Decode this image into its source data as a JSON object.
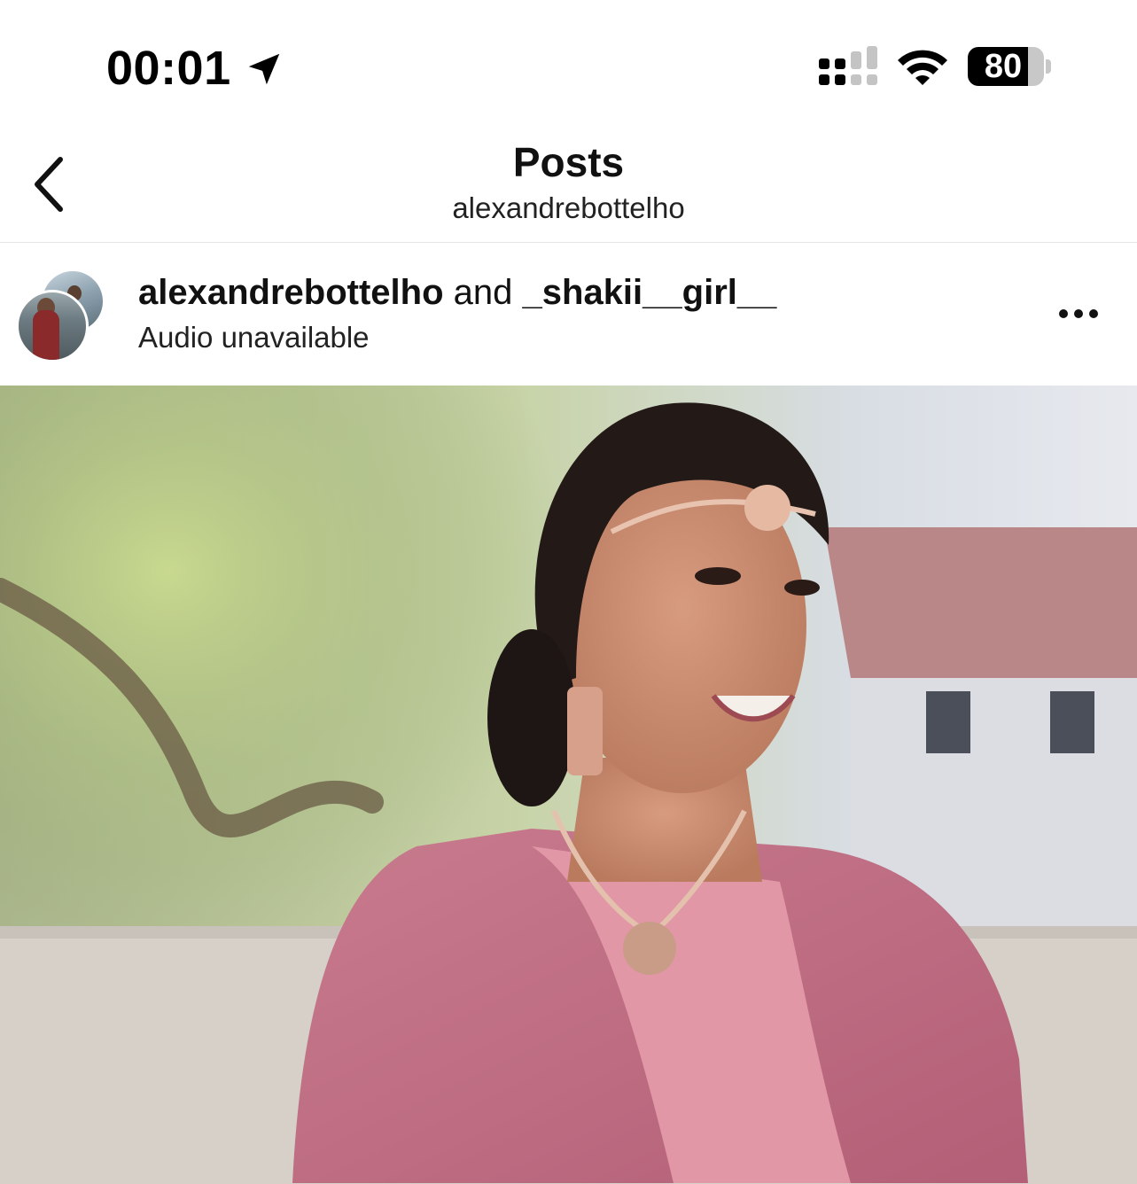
{
  "status_bar": {
    "time": "00:01",
    "battery_level": "80",
    "icons": [
      "location-arrow-icon",
      "cellular-signal-icon",
      "wifi-icon",
      "battery-icon"
    ]
  },
  "header": {
    "title": "Posts",
    "subtitle": "alexandrebottelho",
    "back_icon": "chevron-left-icon"
  },
  "post": {
    "user_primary": "alexandrebottelho",
    "joiner": "and",
    "user_secondary": "_shakii__girl__",
    "audio_status": "Audio unavailable",
    "more_icon": "more-horizontal-icon",
    "media_type": "photo"
  },
  "colors": {
    "background": "#ffffff",
    "text": "#111111",
    "divider": "#e5e5e5",
    "saree_pink": "#c9738a"
  }
}
